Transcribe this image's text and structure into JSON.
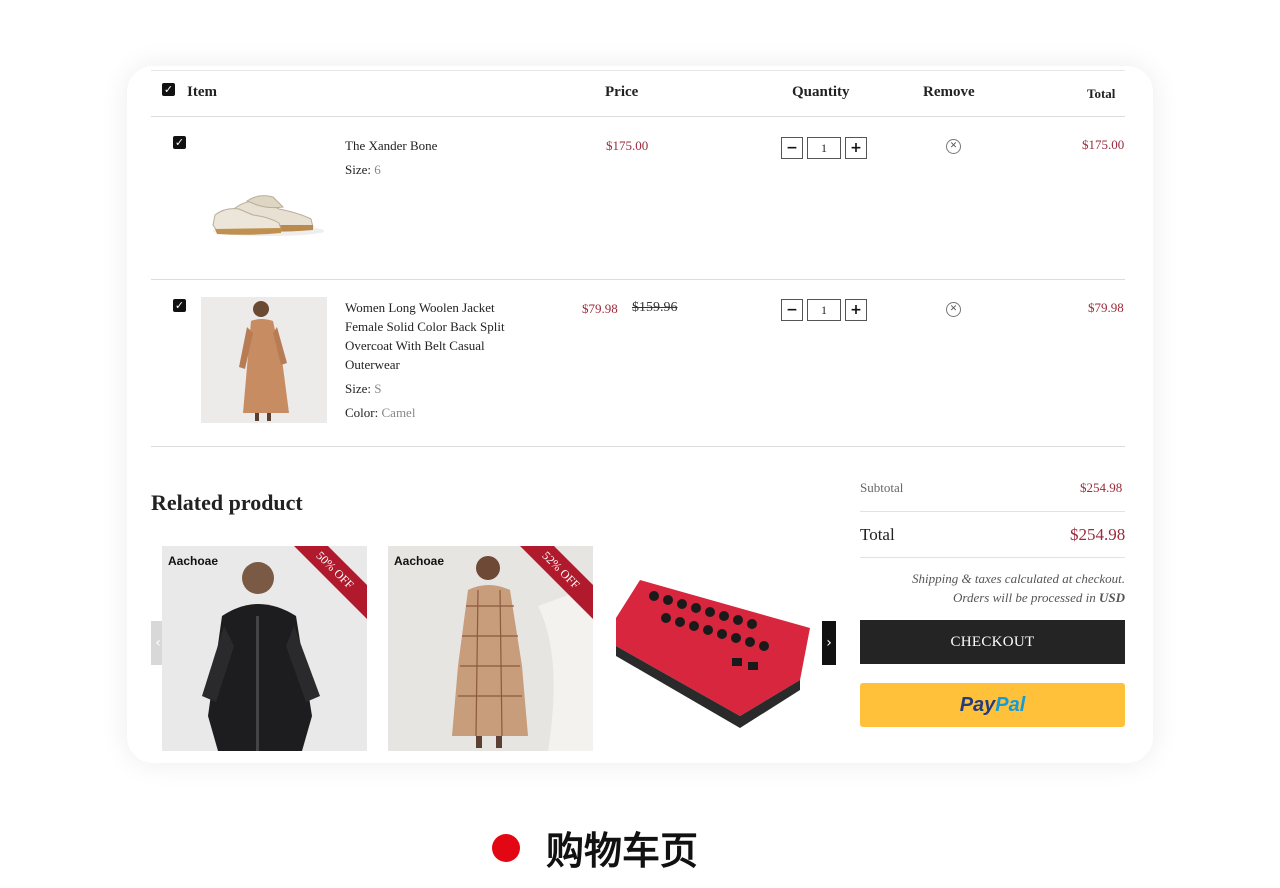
{
  "cart": {
    "headers": {
      "item": "Item",
      "price": "Price",
      "quantity": "Quantity",
      "remove": "Remove",
      "total": "Total"
    },
    "items": [
      {
        "name": "The Xander Bone",
        "size_label": "Size",
        "size": "6",
        "price": "$175.00",
        "quantity": "1",
        "total": "$175.00"
      },
      {
        "name": "Women Long Woolen Jacket Female Solid Color Back Split Overcoat With Belt Casual Outerwear",
        "size_label": "Size",
        "size": "S",
        "color_label": "Color",
        "color": "Camel",
        "price": "$79.98",
        "compare_price": "$159.96",
        "quantity": "1",
        "total": "$79.98"
      }
    ]
  },
  "related": {
    "title": "Related product",
    "products": [
      {
        "brand": "Aachoae",
        "badge": "50% OFF"
      },
      {
        "brand": "Aachoae",
        "badge": "52% OFF"
      },
      {}
    ]
  },
  "summary": {
    "subtotal_label": "Subtotal",
    "subtotal": "$254.98",
    "total_label": "Total",
    "total": "$254.98",
    "note_line1": "Shipping & taxes calculated at checkout.",
    "note_line2_prefix": "Orders will be processed in",
    "note_currency": "USD",
    "checkout_label": "CHECKOUT",
    "paypal_part1": "Pay",
    "paypal_part2": "Pal"
  },
  "caption": "购物车页",
  "colors": {
    "price": "#9b2a3b",
    "checkout_bg": "#242424",
    "paypal_bg": "#fec139",
    "badge": "#b01a2c",
    "caption_dot": "#e30613"
  }
}
